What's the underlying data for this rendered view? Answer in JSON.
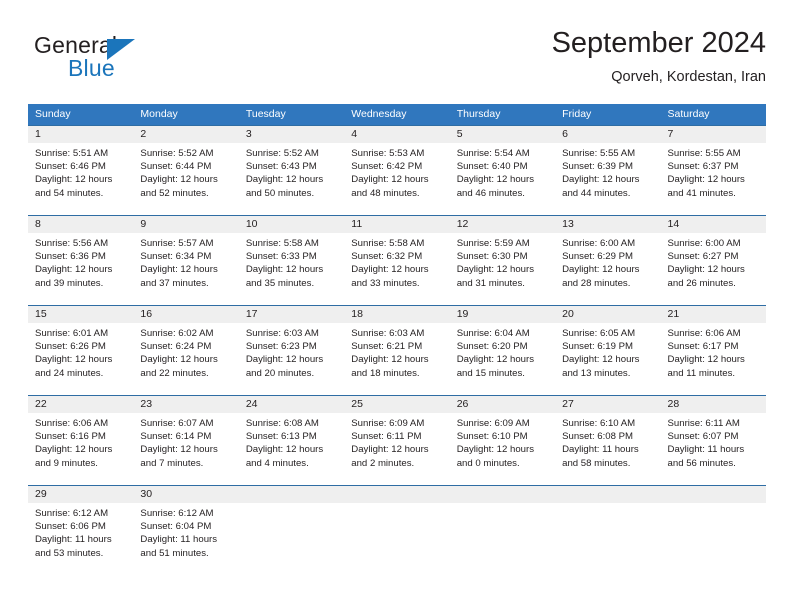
{
  "brand": {
    "name_top": "General",
    "name_bottom": "Blue",
    "triangle_icon": "blue-triangle-logo-mark",
    "color_dark": "#231f20",
    "color_blue": "#1b75bb"
  },
  "header": {
    "title": "September 2024",
    "subtitle": "Qorveh, Kordestan, Iran"
  },
  "theme": {
    "header_blue": "#3077be",
    "row_divider_blue": "#2e6da4",
    "daynum_strip": "#efefef",
    "text": "#231f20"
  },
  "weekdays": [
    "Sunday",
    "Monday",
    "Tuesday",
    "Wednesday",
    "Thursday",
    "Friday",
    "Saturday"
  ],
  "weeks": [
    [
      {
        "day": "1",
        "sunrise": "Sunrise: 5:51 AM",
        "sunset": "Sunset: 6:46 PM",
        "daylight1": "Daylight: 12 hours",
        "daylight2": "and 54 minutes."
      },
      {
        "day": "2",
        "sunrise": "Sunrise: 5:52 AM",
        "sunset": "Sunset: 6:44 PM",
        "daylight1": "Daylight: 12 hours",
        "daylight2": "and 52 minutes."
      },
      {
        "day": "3",
        "sunrise": "Sunrise: 5:52 AM",
        "sunset": "Sunset: 6:43 PM",
        "daylight1": "Daylight: 12 hours",
        "daylight2": "and 50 minutes."
      },
      {
        "day": "4",
        "sunrise": "Sunrise: 5:53 AM",
        "sunset": "Sunset: 6:42 PM",
        "daylight1": "Daylight: 12 hours",
        "daylight2": "and 48 minutes."
      },
      {
        "day": "5",
        "sunrise": "Sunrise: 5:54 AM",
        "sunset": "Sunset: 6:40 PM",
        "daylight1": "Daylight: 12 hours",
        "daylight2": "and 46 minutes."
      },
      {
        "day": "6",
        "sunrise": "Sunrise: 5:55 AM",
        "sunset": "Sunset: 6:39 PM",
        "daylight1": "Daylight: 12 hours",
        "daylight2": "and 44 minutes."
      },
      {
        "day": "7",
        "sunrise": "Sunrise: 5:55 AM",
        "sunset": "Sunset: 6:37 PM",
        "daylight1": "Daylight: 12 hours",
        "daylight2": "and 41 minutes."
      }
    ],
    [
      {
        "day": "8",
        "sunrise": "Sunrise: 5:56 AM",
        "sunset": "Sunset: 6:36 PM",
        "daylight1": "Daylight: 12 hours",
        "daylight2": "and 39 minutes."
      },
      {
        "day": "9",
        "sunrise": "Sunrise: 5:57 AM",
        "sunset": "Sunset: 6:34 PM",
        "daylight1": "Daylight: 12 hours",
        "daylight2": "and 37 minutes."
      },
      {
        "day": "10",
        "sunrise": "Sunrise: 5:58 AM",
        "sunset": "Sunset: 6:33 PM",
        "daylight1": "Daylight: 12 hours",
        "daylight2": "and 35 minutes."
      },
      {
        "day": "11",
        "sunrise": "Sunrise: 5:58 AM",
        "sunset": "Sunset: 6:32 PM",
        "daylight1": "Daylight: 12 hours",
        "daylight2": "and 33 minutes."
      },
      {
        "day": "12",
        "sunrise": "Sunrise: 5:59 AM",
        "sunset": "Sunset: 6:30 PM",
        "daylight1": "Daylight: 12 hours",
        "daylight2": "and 31 minutes."
      },
      {
        "day": "13",
        "sunrise": "Sunrise: 6:00 AM",
        "sunset": "Sunset: 6:29 PM",
        "daylight1": "Daylight: 12 hours",
        "daylight2": "and 28 minutes."
      },
      {
        "day": "14",
        "sunrise": "Sunrise: 6:00 AM",
        "sunset": "Sunset: 6:27 PM",
        "daylight1": "Daylight: 12 hours",
        "daylight2": "and 26 minutes."
      }
    ],
    [
      {
        "day": "15",
        "sunrise": "Sunrise: 6:01 AM",
        "sunset": "Sunset: 6:26 PM",
        "daylight1": "Daylight: 12 hours",
        "daylight2": "and 24 minutes."
      },
      {
        "day": "16",
        "sunrise": "Sunrise: 6:02 AM",
        "sunset": "Sunset: 6:24 PM",
        "daylight1": "Daylight: 12 hours",
        "daylight2": "and 22 minutes."
      },
      {
        "day": "17",
        "sunrise": "Sunrise: 6:03 AM",
        "sunset": "Sunset: 6:23 PM",
        "daylight1": "Daylight: 12 hours",
        "daylight2": "and 20 minutes."
      },
      {
        "day": "18",
        "sunrise": "Sunrise: 6:03 AM",
        "sunset": "Sunset: 6:21 PM",
        "daylight1": "Daylight: 12 hours",
        "daylight2": "and 18 minutes."
      },
      {
        "day": "19",
        "sunrise": "Sunrise: 6:04 AM",
        "sunset": "Sunset: 6:20 PM",
        "daylight1": "Daylight: 12 hours",
        "daylight2": "and 15 minutes."
      },
      {
        "day": "20",
        "sunrise": "Sunrise: 6:05 AM",
        "sunset": "Sunset: 6:19 PM",
        "daylight1": "Daylight: 12 hours",
        "daylight2": "and 13 minutes."
      },
      {
        "day": "21",
        "sunrise": "Sunrise: 6:06 AM",
        "sunset": "Sunset: 6:17 PM",
        "daylight1": "Daylight: 12 hours",
        "daylight2": "and 11 minutes."
      }
    ],
    [
      {
        "day": "22",
        "sunrise": "Sunrise: 6:06 AM",
        "sunset": "Sunset: 6:16 PM",
        "daylight1": "Daylight: 12 hours",
        "daylight2": "and 9 minutes."
      },
      {
        "day": "23",
        "sunrise": "Sunrise: 6:07 AM",
        "sunset": "Sunset: 6:14 PM",
        "daylight1": "Daylight: 12 hours",
        "daylight2": "and 7 minutes."
      },
      {
        "day": "24",
        "sunrise": "Sunrise: 6:08 AM",
        "sunset": "Sunset: 6:13 PM",
        "daylight1": "Daylight: 12 hours",
        "daylight2": "and 4 minutes."
      },
      {
        "day": "25",
        "sunrise": "Sunrise: 6:09 AM",
        "sunset": "Sunset: 6:11 PM",
        "daylight1": "Daylight: 12 hours",
        "daylight2": "and 2 minutes."
      },
      {
        "day": "26",
        "sunrise": "Sunrise: 6:09 AM",
        "sunset": "Sunset: 6:10 PM",
        "daylight1": "Daylight: 12 hours",
        "daylight2": "and 0 minutes."
      },
      {
        "day": "27",
        "sunrise": "Sunrise: 6:10 AM",
        "sunset": "Sunset: 6:08 PM",
        "daylight1": "Daylight: 11 hours",
        "daylight2": "and 58 minutes."
      },
      {
        "day": "28",
        "sunrise": "Sunrise: 6:11 AM",
        "sunset": "Sunset: 6:07 PM",
        "daylight1": "Daylight: 11 hours",
        "daylight2": "and 56 minutes."
      }
    ],
    [
      {
        "day": "29",
        "sunrise": "Sunrise: 6:12 AM",
        "sunset": "Sunset: 6:06 PM",
        "daylight1": "Daylight: 11 hours",
        "daylight2": "and 53 minutes."
      },
      {
        "day": "30",
        "sunrise": "Sunrise: 6:12 AM",
        "sunset": "Sunset: 6:04 PM",
        "daylight1": "Daylight: 11 hours",
        "daylight2": "and 51 minutes."
      },
      {
        "day": "",
        "sunrise": "",
        "sunset": "",
        "daylight1": "",
        "daylight2": ""
      },
      {
        "day": "",
        "sunrise": "",
        "sunset": "",
        "daylight1": "",
        "daylight2": ""
      },
      {
        "day": "",
        "sunrise": "",
        "sunset": "",
        "daylight1": "",
        "daylight2": ""
      },
      {
        "day": "",
        "sunrise": "",
        "sunset": "",
        "daylight1": "",
        "daylight2": ""
      },
      {
        "day": "",
        "sunrise": "",
        "sunset": "",
        "daylight1": "",
        "daylight2": ""
      }
    ]
  ]
}
